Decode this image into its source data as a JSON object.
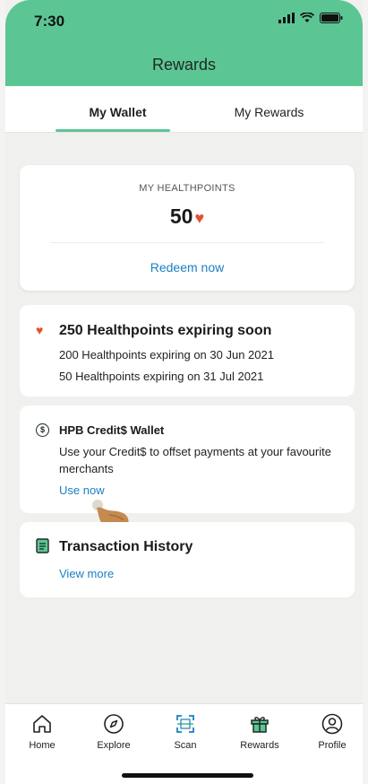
{
  "status": {
    "time": "7:30"
  },
  "header": {
    "title": "Rewards"
  },
  "tabs": [
    {
      "label": "My Wallet",
      "active": true
    },
    {
      "label": "My Rewards",
      "active": false
    }
  ],
  "healthpoints": {
    "label": "MY HEALTHPOINTS",
    "value": "50",
    "redeem_label": "Redeem now"
  },
  "expiring": {
    "title": "250 Healthpoints expiring soon",
    "lines": [
      "200 Healthpoints expiring on 30 Jun 2021",
      "50 Healthpoints expiring on 31 Jul 2021"
    ]
  },
  "credit_wallet": {
    "title": "HPB Credit$ Wallet",
    "description": "Use your Credit$ to offset payments at your favourite merchants",
    "use_label": "Use now"
  },
  "transactions": {
    "title": "Transaction History",
    "more_label": "View more"
  },
  "bottom_nav": [
    {
      "label": "Home",
      "icon": "home-icon"
    },
    {
      "label": "Explore",
      "icon": "compass-icon"
    },
    {
      "label": "Scan",
      "icon": "scan-icon"
    },
    {
      "label": "Rewards",
      "icon": "gift-icon"
    },
    {
      "label": "Profile",
      "icon": "profile-icon"
    }
  ],
  "colors": {
    "brand_green": "#5cc594",
    "link_blue": "#1a7fc1",
    "heart_red": "#e4512f"
  }
}
